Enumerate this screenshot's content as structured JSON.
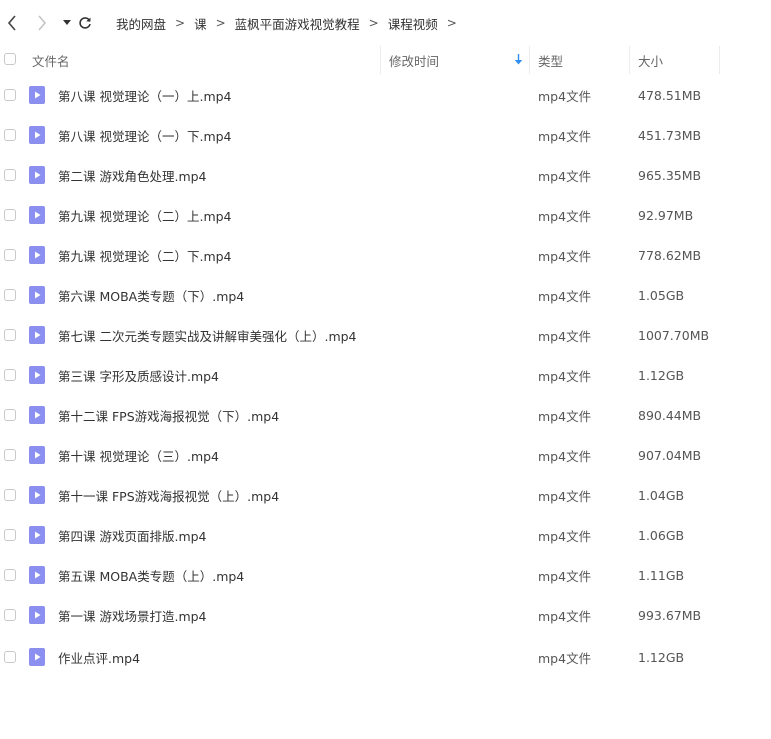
{
  "toolbar": {
    "breadcrumb": [
      "我的网盘",
      "课",
      "蓝枫平面游戏视觉教程",
      "课程视频"
    ],
    "separator": ">"
  },
  "header": {
    "name": "文件名",
    "modified": "修改时间",
    "type": "类型",
    "size": "大小"
  },
  "accent_color": "#8a8ff0",
  "sort_color": "#2f8ef4",
  "files": [
    {
      "name": "第八课 视觉理论（一）上.mp4",
      "type": "mp4文件",
      "size": "478.51MB"
    },
    {
      "name": "第八课 视觉理论（一）下.mp4",
      "type": "mp4文件",
      "size": "451.73MB"
    },
    {
      "name": "第二课 游戏角色处理.mp4",
      "type": "mp4文件",
      "size": "965.35MB"
    },
    {
      "name": "第九课 视觉理论（二）上.mp4",
      "type": "mp4文件",
      "size": "92.97MB"
    },
    {
      "name": "第九课 视觉理论（二）下.mp4",
      "type": "mp4文件",
      "size": "778.62MB"
    },
    {
      "name": "第六课 MOBA类专题（下）.mp4",
      "type": "mp4文件",
      "size": "1.05GB"
    },
    {
      "name": "第七课 二次元类专题实战及讲解审美强化（上）.mp4",
      "type": "mp4文件",
      "size": "1007.70MB"
    },
    {
      "name": "第三课 字形及质感设计.mp4",
      "type": "mp4文件",
      "size": "1.12GB"
    },
    {
      "name": "第十二课 FPS游戏海报视觉（下）.mp4",
      "type": "mp4文件",
      "size": "890.44MB"
    },
    {
      "name": "第十课 视觉理论（三）.mp4",
      "type": "mp4文件",
      "size": "907.04MB"
    },
    {
      "name": "第十一课 FPS游戏海报视觉（上）.mp4",
      "type": "mp4文件",
      "size": "1.04GB"
    },
    {
      "name": "第四课 游戏页面排版.mp4",
      "type": "mp4文件",
      "size": "1.06GB"
    },
    {
      "name": "第五课 MOBA类专题（上）.mp4",
      "type": "mp4文件",
      "size": "1.11GB"
    },
    {
      "name": "第一课 游戏场景打造.mp4",
      "type": "mp4文件",
      "size": "993.67MB"
    },
    {
      "name": "作业点评.mp4",
      "type": "mp4文件",
      "size": "1.12GB"
    }
  ]
}
